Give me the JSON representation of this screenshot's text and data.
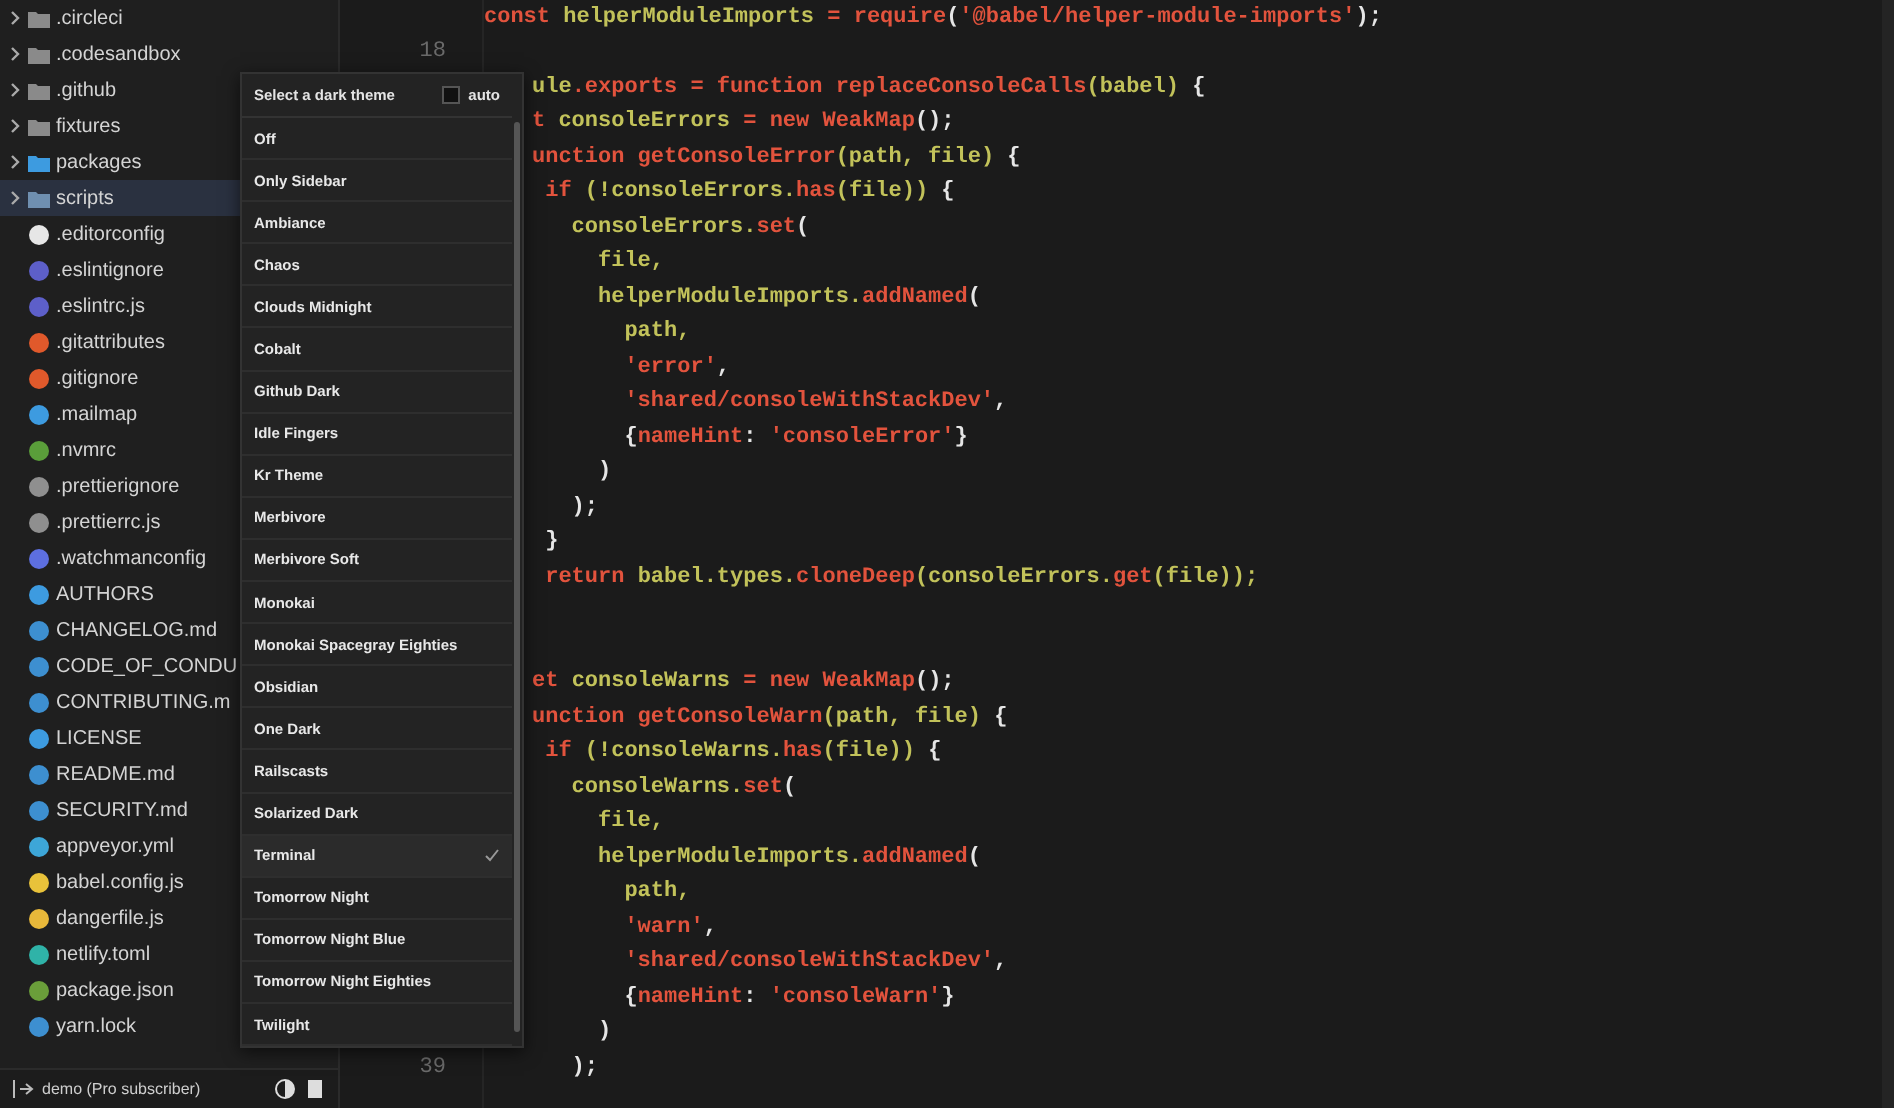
{
  "sidebar": {
    "items": [
      {
        "name": ".circleci",
        "kind": "folder",
        "color": "#8a8a8a",
        "selected": false
      },
      {
        "name": ".codesandbox",
        "kind": "folder",
        "color": "#8a8a8a",
        "selected": false
      },
      {
        "name": ".github",
        "kind": "folder",
        "color": "#8a8a8a",
        "selected": false
      },
      {
        "name": "fixtures",
        "kind": "folder",
        "color": "#8a8a8a",
        "selected": false
      },
      {
        "name": "packages",
        "kind": "folder",
        "color": "#3d9be0",
        "selected": false
      },
      {
        "name": "scripts",
        "kind": "folder",
        "color": "#6f8fb0",
        "selected": true
      },
      {
        "name": ".editorconfig",
        "kind": "file",
        "color": "#e6e6e6",
        "selected": false
      },
      {
        "name": ".eslintignore",
        "kind": "file",
        "color": "#5d5fc9",
        "selected": false
      },
      {
        "name": ".eslintrc.js",
        "kind": "file",
        "color": "#5d5fc9",
        "selected": false
      },
      {
        "name": ".gitattributes",
        "kind": "file",
        "color": "#e0592b",
        "selected": false
      },
      {
        "name": ".gitignore",
        "kind": "file",
        "color": "#e0592b",
        "selected": false
      },
      {
        "name": ".mailmap",
        "kind": "file",
        "color": "#3d9be0",
        "selected": false
      },
      {
        "name": ".nvmrc",
        "kind": "file",
        "color": "#5a9e3a",
        "selected": false
      },
      {
        "name": ".prettierignore",
        "kind": "file",
        "color": "#8f8f8f",
        "selected": false
      },
      {
        "name": ".prettierrc.js",
        "kind": "file",
        "color": "#8f8f8f",
        "selected": false
      },
      {
        "name": ".watchmanconfig",
        "kind": "file",
        "color": "#5d6fe0",
        "selected": false
      },
      {
        "name": "AUTHORS",
        "kind": "file",
        "color": "#3d9be0",
        "selected": false
      },
      {
        "name": "CHANGELOG.md",
        "kind": "file",
        "color": "#3d8fd0",
        "selected": false
      },
      {
        "name": "CODE_OF_CONDU",
        "kind": "file",
        "color": "#3d8fd0",
        "selected": false
      },
      {
        "name": "CONTRIBUTING.m",
        "kind": "file",
        "color": "#3d8fd0",
        "selected": false
      },
      {
        "name": "LICENSE",
        "kind": "file",
        "color": "#3d9be0",
        "selected": false
      },
      {
        "name": "README.md",
        "kind": "file",
        "color": "#3d8fd0",
        "selected": false
      },
      {
        "name": "SECURITY.md",
        "kind": "file",
        "color": "#3d8fd0",
        "selected": false
      },
      {
        "name": "appveyor.yml",
        "kind": "file",
        "color": "#3da6d8",
        "selected": false
      },
      {
        "name": "babel.config.js",
        "kind": "file",
        "color": "#e8c23a",
        "selected": false
      },
      {
        "name": "dangerfile.js",
        "kind": "file",
        "color": "#e8b83a",
        "selected": false
      },
      {
        "name": "netlify.toml",
        "kind": "file",
        "color": "#2fb3a8",
        "selected": false
      },
      {
        "name": "package.json",
        "kind": "file",
        "color": "#6a9e3a",
        "selected": false
      },
      {
        "name": "yarn.lock",
        "kind": "file",
        "color": "#3d8fd0",
        "selected": false
      }
    ]
  },
  "status_bar": {
    "user": "demo (Pro subscriber)"
  },
  "code": {
    "lines": [
      {
        "kind": "full",
        "tokens": [
          {
            "text": "const ",
            "kind": "keyword"
          },
          {
            "text": "helperModuleImports ",
            "kind": "name"
          },
          {
            "text": "= require",
            "kind": "keyword"
          },
          {
            "text": "(",
            "kind": "punct"
          },
          {
            "text": "'@babel/helper-module-imports'",
            "kind": "keyword"
          },
          {
            "text": ");",
            "kind": "punct"
          }
        ]
      },
      {
        "kind": "clipped",
        "number": "18"
      },
      {
        "kind": "clipped",
        "tokens": [
          {
            "text": "ule",
            "kind": "name"
          },
          {
            "text": ".exports = function replaceConsoleCalls",
            "kind": "keyword"
          },
          {
            "text": "(babel) ",
            "kind": "name"
          },
          {
            "text": "{",
            "kind": "punct"
          }
        ]
      },
      {
        "kind": "clipped",
        "tokens": [
          {
            "text": "t ",
            "kind": "keyword"
          },
          {
            "text": "consoleErrors ",
            "kind": "name"
          },
          {
            "text": "= new WeakMap",
            "kind": "keyword"
          },
          {
            "text": "();",
            "kind": "punct"
          }
        ]
      },
      {
        "kind": "clipped",
        "tokens": [
          {
            "text": "unction getConsoleError",
            "kind": "keyword"
          },
          {
            "text": "(path, file) ",
            "kind": "name"
          },
          {
            "text": "{",
            "kind": "punct"
          }
        ]
      },
      {
        "kind": "clipped",
        "tokens": [
          {
            "text": " if ",
            "kind": "keyword"
          },
          {
            "text": "(!consoleErrors.",
            "kind": "name"
          },
          {
            "text": "has",
            "kind": "keyword"
          },
          {
            "text": "(file)) ",
            "kind": "name"
          },
          {
            "text": "{",
            "kind": "punct"
          }
        ]
      },
      {
        "kind": "clipped",
        "tokens": [
          {
            "text": "   consoleErrors.",
            "kind": "name"
          },
          {
            "text": "set",
            "kind": "keyword"
          },
          {
            "text": "(",
            "kind": "punct"
          }
        ]
      },
      {
        "kind": "clipped",
        "tokens": [
          {
            "text": "     file,",
            "kind": "name"
          }
        ]
      },
      {
        "kind": "clipped",
        "tokens": [
          {
            "text": "     helperModuleImports.",
            "kind": "name"
          },
          {
            "text": "addNamed",
            "kind": "keyword"
          },
          {
            "text": "(",
            "kind": "punct"
          }
        ]
      },
      {
        "kind": "clipped",
        "tokens": [
          {
            "text": "       path,",
            "kind": "name"
          }
        ]
      },
      {
        "kind": "clipped",
        "tokens": [
          {
            "text": "       'error'",
            "kind": "keyword"
          },
          {
            "text": ",",
            "kind": "punct"
          }
        ]
      },
      {
        "kind": "clipped",
        "tokens": [
          {
            "text": "       'shared/consoleWithStackDev'",
            "kind": "keyword"
          },
          {
            "text": ",",
            "kind": "punct"
          }
        ]
      },
      {
        "kind": "clipped",
        "tokens": [
          {
            "text": "       {",
            "kind": "punct"
          },
          {
            "text": "nameHint",
            "kind": "keyword"
          },
          {
            "text": ": ",
            "kind": "punct"
          },
          {
            "text": "'consoleError'",
            "kind": "keyword"
          },
          {
            "text": "}",
            "kind": "punct"
          }
        ]
      },
      {
        "kind": "clipped",
        "tokens": [
          {
            "text": "     )",
            "kind": "punct"
          }
        ]
      },
      {
        "kind": "clipped",
        "tokens": [
          {
            "text": "   );",
            "kind": "punct"
          }
        ]
      },
      {
        "kind": "clipped",
        "tokens": [
          {
            "text": " }",
            "kind": "punct"
          }
        ]
      },
      {
        "kind": "clipped",
        "tokens": [
          {
            "text": " return ",
            "kind": "keyword"
          },
          {
            "text": "babel.types.",
            "kind": "name"
          },
          {
            "text": "cloneDeep",
            "kind": "keyword"
          },
          {
            "text": "(consoleErrors.",
            "kind": "name"
          },
          {
            "text": "get",
            "kind": "keyword"
          },
          {
            "text": "(file));",
            "kind": "name"
          }
        ]
      },
      {
        "kind": "clipped"
      },
      {
        "kind": "clipped"
      },
      {
        "kind": "clipped",
        "tokens": [
          {
            "text": "et ",
            "kind": "keyword"
          },
          {
            "text": "consoleWarns ",
            "kind": "name"
          },
          {
            "text": "= new WeakMap",
            "kind": "keyword"
          },
          {
            "text": "();",
            "kind": "punct"
          }
        ]
      },
      {
        "kind": "clipped",
        "tokens": [
          {
            "text": "unction getConsoleWarn",
            "kind": "keyword"
          },
          {
            "text": "(path, file) ",
            "kind": "name"
          },
          {
            "text": "{",
            "kind": "punct"
          }
        ]
      },
      {
        "kind": "clipped",
        "tokens": [
          {
            "text": " if ",
            "kind": "keyword"
          },
          {
            "text": "(!consoleWarns.",
            "kind": "name"
          },
          {
            "text": "has",
            "kind": "keyword"
          },
          {
            "text": "(file)) ",
            "kind": "name"
          },
          {
            "text": "{",
            "kind": "punct"
          }
        ]
      },
      {
        "kind": "clipped",
        "tokens": [
          {
            "text": "   consoleWarns.",
            "kind": "name"
          },
          {
            "text": "set",
            "kind": "keyword"
          },
          {
            "text": "(",
            "kind": "punct"
          }
        ]
      },
      {
        "kind": "clipped",
        "tokens": [
          {
            "text": "     file,",
            "kind": "name"
          }
        ]
      },
      {
        "kind": "clipped",
        "tokens": [
          {
            "text": "     helperModuleImports.",
            "kind": "name"
          },
          {
            "text": "addNamed",
            "kind": "keyword"
          },
          {
            "text": "(",
            "kind": "punct"
          }
        ]
      },
      {
        "kind": "clipped",
        "tokens": [
          {
            "text": "       path,",
            "kind": "name"
          }
        ]
      },
      {
        "kind": "clipped",
        "tokens": [
          {
            "text": "       'warn'",
            "kind": "keyword"
          },
          {
            "text": ",",
            "kind": "punct"
          }
        ]
      },
      {
        "kind": "clipped",
        "tokens": [
          {
            "text": "       'shared/consoleWithStackDev'",
            "kind": "keyword"
          },
          {
            "text": ",",
            "kind": "punct"
          }
        ]
      },
      {
        "kind": "clipped",
        "tokens": [
          {
            "text": "       {",
            "kind": "punct"
          },
          {
            "text": "nameHint",
            "kind": "keyword"
          },
          {
            "text": ": ",
            "kind": "punct"
          },
          {
            "text": "'consoleWarn'",
            "kind": "keyword"
          },
          {
            "text": "}",
            "kind": "punct"
          }
        ]
      },
      {
        "kind": "clipped",
        "tokens": [
          {
            "text": "     )",
            "kind": "punct"
          }
        ]
      },
      {
        "kind": "clipped",
        "number": "39",
        "tokens": [
          {
            "text": "   );",
            "kind": "punct"
          }
        ]
      }
    ]
  },
  "theme_menu": {
    "title": "Select a dark theme",
    "auto": {
      "label": "auto",
      "checked": false
    },
    "items": [
      {
        "label": "Off",
        "selected": false
      },
      {
        "label": "Only Sidebar",
        "selected": false
      },
      {
        "label": "Ambiance",
        "selected": false
      },
      {
        "label": "Chaos",
        "selected": false
      },
      {
        "label": "Clouds Midnight",
        "selected": false
      },
      {
        "label": "Cobalt",
        "selected": false
      },
      {
        "label": "Github Dark",
        "selected": false
      },
      {
        "label": "Idle Fingers",
        "selected": false
      },
      {
        "label": "Kr Theme",
        "selected": false
      },
      {
        "label": "Merbivore",
        "selected": false
      },
      {
        "label": "Merbivore Soft",
        "selected": false
      },
      {
        "label": "Monokai",
        "selected": false
      },
      {
        "label": "Monokai Spacegray Eighties",
        "selected": false
      },
      {
        "label": "Obsidian",
        "selected": false
      },
      {
        "label": "One Dark",
        "selected": false
      },
      {
        "label": "Railscasts",
        "selected": false
      },
      {
        "label": "Solarized Dark",
        "selected": false
      },
      {
        "label": "Terminal",
        "selected": true
      },
      {
        "label": "Tomorrow Night",
        "selected": false
      },
      {
        "label": "Tomorrow Night Blue",
        "selected": false
      },
      {
        "label": "Tomorrow Night Eighties",
        "selected": false
      },
      {
        "label": "Twilight",
        "selected": false
      }
    ]
  }
}
